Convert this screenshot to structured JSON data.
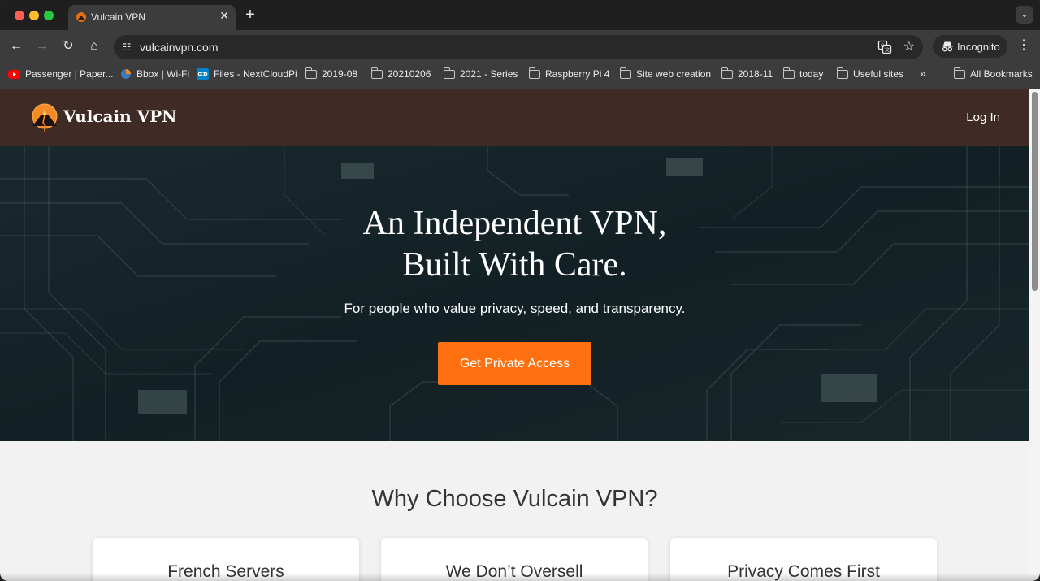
{
  "browser": {
    "tab": {
      "title": "Vulcain VPN",
      "close": "✕"
    },
    "new_tab": "+",
    "tab_menu": "⌄",
    "nav": {
      "back": "←",
      "forward": "→",
      "reload": "↻",
      "home": "⌂"
    },
    "address": {
      "url": "vulcainvpn.com"
    },
    "star": "☆",
    "incognito_label": "Incognito",
    "menu": "⋮",
    "bookmarks": [
      {
        "label": "Passenger | Paper...",
        "icon": "youtube-icon"
      },
      {
        "label": "Bbox | Wi-Fi",
        "icon": "bbox-icon"
      },
      {
        "label": "Files - NextCloudPi",
        "icon": "nextcloud-icon"
      },
      {
        "label": "2019-08",
        "icon": "folder-icon"
      },
      {
        "label": "20210206",
        "icon": "folder-icon"
      },
      {
        "label": "2021 - Series",
        "icon": "folder-icon"
      },
      {
        "label": "Raspberry Pi 4",
        "icon": "folder-icon"
      },
      {
        "label": "Site web creation",
        "icon": "folder-icon"
      },
      {
        "label": "2018-11",
        "icon": "folder-icon"
      },
      {
        "label": "today",
        "icon": "folder-icon"
      },
      {
        "label": "Useful sites",
        "icon": "folder-icon"
      }
    ],
    "overflow": "»",
    "all_bookmarks": "All Bookmarks"
  },
  "site": {
    "brand": "Vulcain VPN",
    "login": "Log In",
    "hero": {
      "title_line1": "An Independent VPN,",
      "title_line2": "Built With Care.",
      "subtitle": "For people who value privacy, speed, and transparency.",
      "cta": "Get Private Access"
    },
    "why_title": "Why Choose Vulcain VPN?",
    "features": [
      "French Servers",
      "We Don’t Oversell",
      "Privacy Comes First"
    ]
  },
  "colors": {
    "header_bg": "#3f2a25",
    "cta": "#ff7010",
    "hero_overlay": "#152227"
  }
}
